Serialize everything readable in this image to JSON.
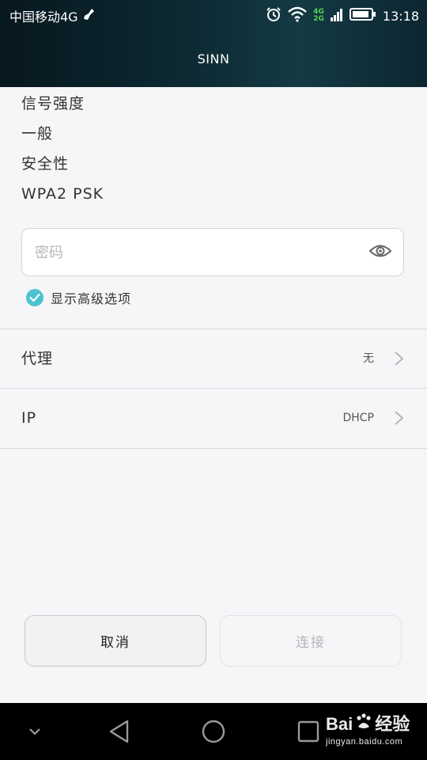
{
  "status_bar": {
    "carrier": "中国移动4G",
    "network_top": "4G",
    "network_bottom": "2G",
    "time": "13:18",
    "icons": [
      "broom-icon",
      "alarm-icon",
      "wifi-icon",
      "signal-icon",
      "battery-icon"
    ]
  },
  "title_bar": {
    "title": "SINN"
  },
  "info": {
    "signal_label": "信号强度",
    "signal_value": "一般",
    "security_label": "安全性",
    "security_value": "WPA2 PSK"
  },
  "password": {
    "placeholder": "密码",
    "value": ""
  },
  "advanced": {
    "label": "显示高级选项",
    "checked": true
  },
  "settings": {
    "proxy": {
      "label": "代理",
      "value": "无"
    },
    "ip": {
      "label": "IP",
      "value": "DHCP"
    }
  },
  "actions": {
    "cancel_label": "取消",
    "connect_label": "连接"
  },
  "nav_bar": {
    "icons": [
      "chevron-down-icon",
      "back-icon",
      "home-icon",
      "recents-icon"
    ]
  },
  "watermark": {
    "brand": "Bai",
    "brand_suffix": "经验",
    "url": "jingyan.baidu.com"
  },
  "colors": {
    "accent": "#4ec3cf",
    "header_dark": "#07171f",
    "background": "#f6f6f8"
  }
}
